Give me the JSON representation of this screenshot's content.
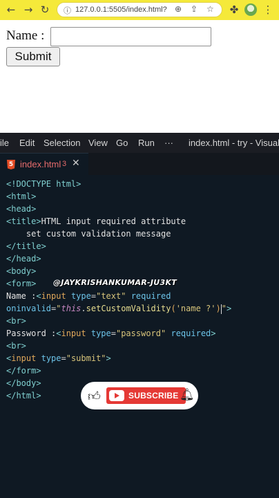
{
  "browser": {
    "url": "127.0.0.1:5505/index.html?"
  },
  "page": {
    "name_label": "Name :",
    "name_value": "",
    "submit_label": "Submit"
  },
  "vscode": {
    "menu": [
      "ile",
      "Edit",
      "Selection",
      "View",
      "Go",
      "Run",
      "···",
      "index.html - try - Visual St"
    ],
    "tab": {
      "name": "index.html",
      "problems": "3"
    },
    "code_lines": {
      "l1": "<!DOCTYPE html>",
      "l2": "<html>",
      "l3": "<head>",
      "l4": "HTML input required attribute",
      "l5": "    set custom validation message",
      "l6": "</title>",
      "l7": "</head>",
      "l8": "<body>",
      "l9": "<form>",
      "l10_prefix": "Name :",
      "l11_fn": "setCustomValidity",
      "l11_arg": "'name ?'",
      "l12": "<br>",
      "l13_prefix": "Password :",
      "l14": "<br>",
      "l16": "</form>",
      "l17": "</body>",
      "l18": "</html>"
    },
    "watermark": "@JAYKRISHANKUMAR-JU3KT"
  },
  "subscribe": {
    "label": "SUBSCRIBE"
  },
  "colors": {
    "browser_bar": "#f5e93a",
    "editor_bg": "#0f1923",
    "youtube_red": "#e53935"
  },
  "icons": [
    "back-arrow-icon",
    "forward-arrow-icon",
    "reload-icon",
    "lock-icon",
    "zoom-icon",
    "share-icon",
    "star-icon",
    "extensions-icon",
    "menu-dots-icon",
    "html5-icon",
    "close-icon",
    "thumbs-up-icon",
    "youtube-logo-icon",
    "bell-icon"
  ]
}
